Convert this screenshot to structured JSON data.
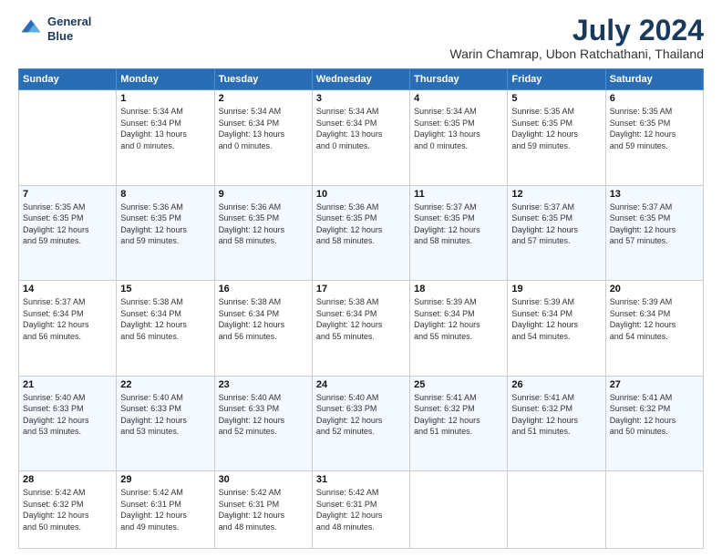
{
  "logo": {
    "line1": "General",
    "line2": "Blue"
  },
  "title": "July 2024",
  "subtitle": "Warin Chamrap, Ubon Ratchathani, Thailand",
  "days_of_week": [
    "Sunday",
    "Monday",
    "Tuesday",
    "Wednesday",
    "Thursday",
    "Friday",
    "Saturday"
  ],
  "weeks": [
    [
      {
        "day": "",
        "info": ""
      },
      {
        "day": "1",
        "info": "Sunrise: 5:34 AM\nSunset: 6:34 PM\nDaylight: 13 hours\nand 0 minutes."
      },
      {
        "day": "2",
        "info": "Sunrise: 5:34 AM\nSunset: 6:34 PM\nDaylight: 13 hours\nand 0 minutes."
      },
      {
        "day": "3",
        "info": "Sunrise: 5:34 AM\nSunset: 6:34 PM\nDaylight: 13 hours\nand 0 minutes."
      },
      {
        "day": "4",
        "info": "Sunrise: 5:34 AM\nSunset: 6:35 PM\nDaylight: 13 hours\nand 0 minutes."
      },
      {
        "day": "5",
        "info": "Sunrise: 5:35 AM\nSunset: 6:35 PM\nDaylight: 12 hours\nand 59 minutes."
      },
      {
        "day": "6",
        "info": "Sunrise: 5:35 AM\nSunset: 6:35 PM\nDaylight: 12 hours\nand 59 minutes."
      }
    ],
    [
      {
        "day": "7",
        "info": "Sunrise: 5:35 AM\nSunset: 6:35 PM\nDaylight: 12 hours\nand 59 minutes."
      },
      {
        "day": "8",
        "info": "Sunrise: 5:36 AM\nSunset: 6:35 PM\nDaylight: 12 hours\nand 59 minutes."
      },
      {
        "day": "9",
        "info": "Sunrise: 5:36 AM\nSunset: 6:35 PM\nDaylight: 12 hours\nand 58 minutes."
      },
      {
        "day": "10",
        "info": "Sunrise: 5:36 AM\nSunset: 6:35 PM\nDaylight: 12 hours\nand 58 minutes."
      },
      {
        "day": "11",
        "info": "Sunrise: 5:37 AM\nSunset: 6:35 PM\nDaylight: 12 hours\nand 58 minutes."
      },
      {
        "day": "12",
        "info": "Sunrise: 5:37 AM\nSunset: 6:35 PM\nDaylight: 12 hours\nand 57 minutes."
      },
      {
        "day": "13",
        "info": "Sunrise: 5:37 AM\nSunset: 6:35 PM\nDaylight: 12 hours\nand 57 minutes."
      }
    ],
    [
      {
        "day": "14",
        "info": "Sunrise: 5:37 AM\nSunset: 6:34 PM\nDaylight: 12 hours\nand 56 minutes."
      },
      {
        "day": "15",
        "info": "Sunrise: 5:38 AM\nSunset: 6:34 PM\nDaylight: 12 hours\nand 56 minutes."
      },
      {
        "day": "16",
        "info": "Sunrise: 5:38 AM\nSunset: 6:34 PM\nDaylight: 12 hours\nand 56 minutes."
      },
      {
        "day": "17",
        "info": "Sunrise: 5:38 AM\nSunset: 6:34 PM\nDaylight: 12 hours\nand 55 minutes."
      },
      {
        "day": "18",
        "info": "Sunrise: 5:39 AM\nSunset: 6:34 PM\nDaylight: 12 hours\nand 55 minutes."
      },
      {
        "day": "19",
        "info": "Sunrise: 5:39 AM\nSunset: 6:34 PM\nDaylight: 12 hours\nand 54 minutes."
      },
      {
        "day": "20",
        "info": "Sunrise: 5:39 AM\nSunset: 6:34 PM\nDaylight: 12 hours\nand 54 minutes."
      }
    ],
    [
      {
        "day": "21",
        "info": "Sunrise: 5:40 AM\nSunset: 6:33 PM\nDaylight: 12 hours\nand 53 minutes."
      },
      {
        "day": "22",
        "info": "Sunrise: 5:40 AM\nSunset: 6:33 PM\nDaylight: 12 hours\nand 53 minutes."
      },
      {
        "day": "23",
        "info": "Sunrise: 5:40 AM\nSunset: 6:33 PM\nDaylight: 12 hours\nand 52 minutes."
      },
      {
        "day": "24",
        "info": "Sunrise: 5:40 AM\nSunset: 6:33 PM\nDaylight: 12 hours\nand 52 minutes."
      },
      {
        "day": "25",
        "info": "Sunrise: 5:41 AM\nSunset: 6:32 PM\nDaylight: 12 hours\nand 51 minutes."
      },
      {
        "day": "26",
        "info": "Sunrise: 5:41 AM\nSunset: 6:32 PM\nDaylight: 12 hours\nand 51 minutes."
      },
      {
        "day": "27",
        "info": "Sunrise: 5:41 AM\nSunset: 6:32 PM\nDaylight: 12 hours\nand 50 minutes."
      }
    ],
    [
      {
        "day": "28",
        "info": "Sunrise: 5:42 AM\nSunset: 6:32 PM\nDaylight: 12 hours\nand 50 minutes."
      },
      {
        "day": "29",
        "info": "Sunrise: 5:42 AM\nSunset: 6:31 PM\nDaylight: 12 hours\nand 49 minutes."
      },
      {
        "day": "30",
        "info": "Sunrise: 5:42 AM\nSunset: 6:31 PM\nDaylight: 12 hours\nand 48 minutes."
      },
      {
        "day": "31",
        "info": "Sunrise: 5:42 AM\nSunset: 6:31 PM\nDaylight: 12 hours\nand 48 minutes."
      },
      {
        "day": "",
        "info": ""
      },
      {
        "day": "",
        "info": ""
      },
      {
        "day": "",
        "info": ""
      }
    ]
  ]
}
